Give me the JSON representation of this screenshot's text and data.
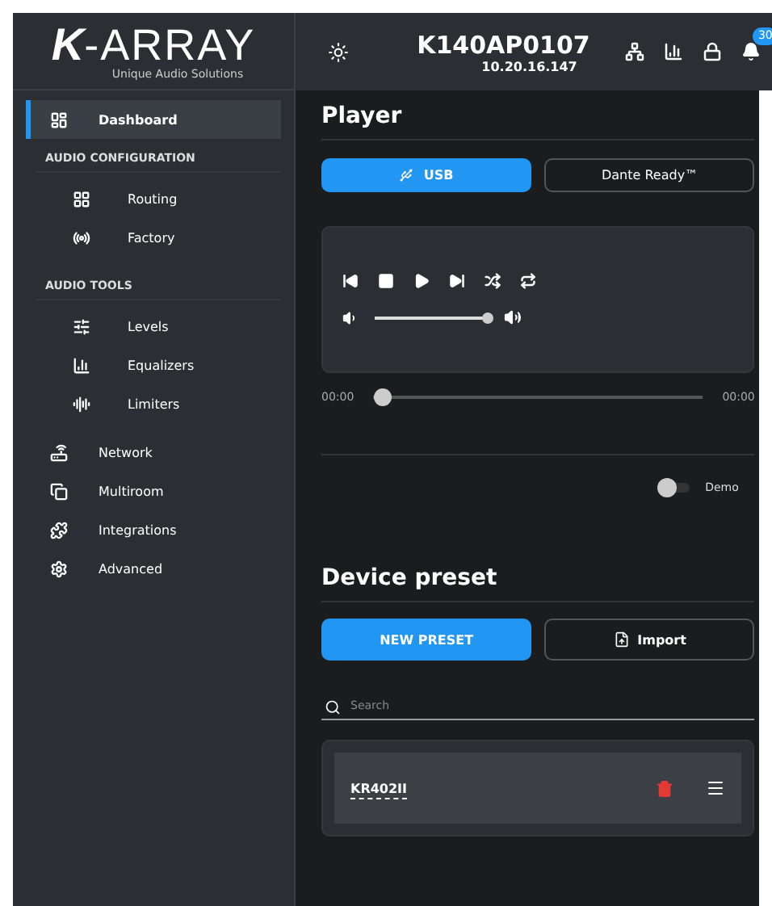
{
  "header": {
    "logo_mark": "K",
    "logo_name": "-ARRAY",
    "tagline": "Unique Audio Solutions",
    "device_name": "K140AP0107",
    "device_ip": "10.20.16.147",
    "notification_count": "30"
  },
  "sidebar": [
    {
      "kind": "item",
      "label": "Dashboard",
      "selected": true
    },
    {
      "kind": "section",
      "label": "AUDIO CONFIGURATION",
      "children": [
        {
          "label": "Routing",
          "selected": false
        },
        {
          "label": "Factory",
          "selected": false
        }
      ]
    },
    {
      "kind": "section",
      "label": "AUDIO TOOLS",
      "children": [
        {
          "label": "Levels",
          "selected": false
        },
        {
          "label": "Equalizers",
          "selected": false
        },
        {
          "label": "Limiters",
          "selected": false
        }
      ]
    },
    {
      "kind": "item",
      "label": "Network",
      "selected": false
    },
    {
      "kind": "item",
      "label": "Multiroom",
      "selected": false
    },
    {
      "kind": "item",
      "label": "Integrations",
      "selected": false
    },
    {
      "kind": "item",
      "label": "Advanced",
      "selected": false
    }
  ],
  "player": {
    "title": "Player",
    "sources": [
      {
        "label": "USB",
        "selected": true
      },
      {
        "label": "Dante Ready™",
        "selected": false
      }
    ],
    "volume": {
      "level": 1
    },
    "progress": {
      "level": 0,
      "elapsed": "00:00",
      "total": "00:00"
    },
    "demo": {
      "label": "Demo",
      "on": false
    }
  },
  "device_preset": {
    "title": "Device preset",
    "new_button": "NEW PRESET",
    "import_button": "Import",
    "search": {
      "placeholder": "Search"
    },
    "presets": [
      {
        "name": "KR402II"
      }
    ]
  }
}
